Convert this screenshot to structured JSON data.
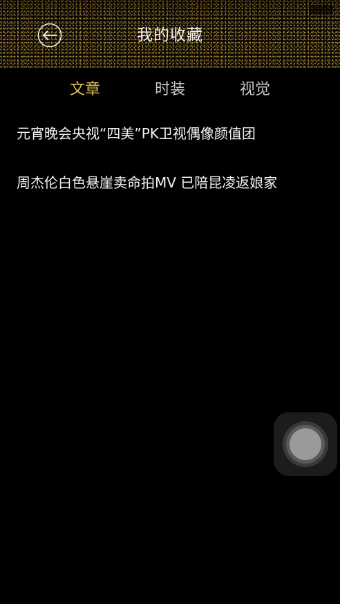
{
  "header": {
    "title": "我的收藏",
    "back_icon": "back-arrow-icon"
  },
  "tabs": [
    {
      "label": "文章",
      "active": true
    },
    {
      "label": "时装",
      "active": false
    },
    {
      "label": "视觉",
      "active": false
    }
  ],
  "articles": [
    {
      "title": "元宵晚会央视“四美”PK卫视偶像颜值团"
    },
    {
      "title": "周杰伦白色悬崖卖命拍MV 已陪昆凌返娘家"
    }
  ],
  "colors": {
    "background": "#000000",
    "active_tab": "#e6bd54",
    "inactive_tab": "#c9c9c9",
    "text": "#f2f2f2"
  }
}
